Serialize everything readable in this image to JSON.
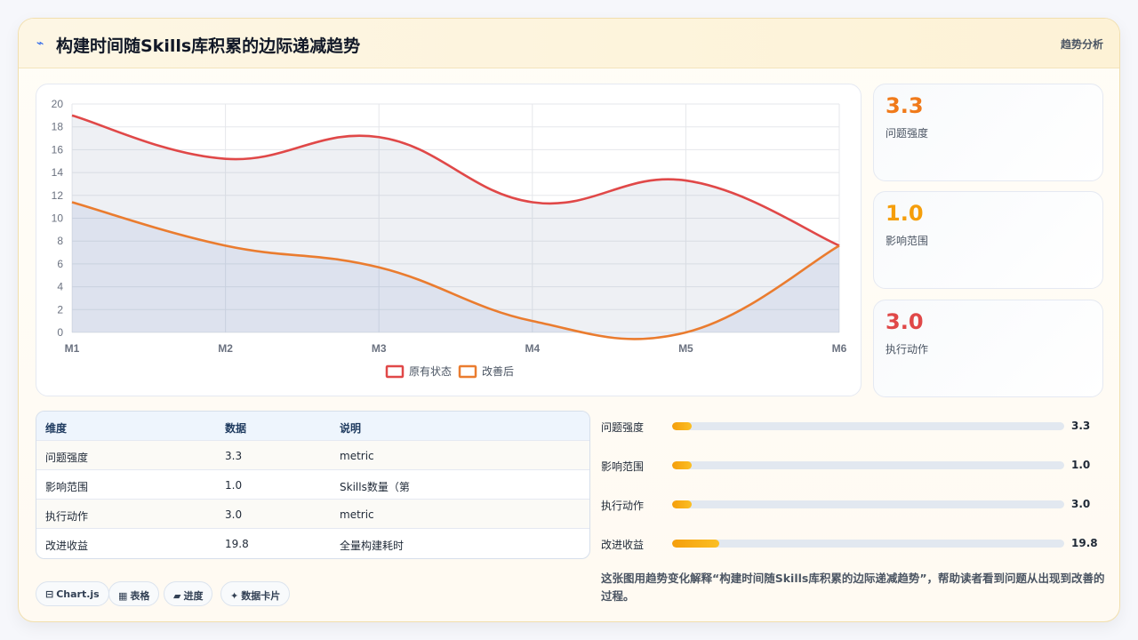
{
  "header": {
    "icon": "trend-icon",
    "title": "构建时间随Skills库积累的边际递减趋势",
    "tag": "趋势分析"
  },
  "chart_data": {
    "type": "line",
    "categories": [
      "M1",
      "M2",
      "M3",
      "M4",
      "M5",
      "M6"
    ],
    "ylim": [
      0,
      20
    ],
    "yticks": [
      0,
      2,
      4,
      6,
      8,
      10,
      12,
      14,
      16,
      18,
      20
    ],
    "grid": true,
    "legend_position": "bottom",
    "series": [
      {
        "name": "原有状态",
        "values": [
          19.0,
          15.2,
          17.1,
          11.4,
          13.3,
          7.6
        ],
        "color": "#e04848"
      },
      {
        "name": "改善后",
        "values": [
          11.4,
          7.6,
          5.7,
          1.0,
          0.0,
          7.6
        ],
        "color": "#ea7c2f"
      }
    ]
  },
  "stats": [
    {
      "value": "3.3",
      "label": "问题强度",
      "color": "#f07a1a"
    },
    {
      "value": "1.0",
      "label": "影响范围",
      "color": "#f59e0b"
    },
    {
      "value": "3.0",
      "label": "执行动作",
      "color": "#e04848"
    }
  ],
  "table": {
    "headers": [
      "维度",
      "数据",
      "说明"
    ],
    "rows": [
      [
        "问题强度",
        "3.3",
        "metric"
      ],
      [
        "影响范围",
        "1.0",
        "Skills数量（第"
      ],
      [
        "执行动作",
        "3.0",
        "metric"
      ],
      [
        "改进收益",
        "19.8",
        "全量构建耗时"
      ]
    ]
  },
  "bars": [
    {
      "label": "问题强度",
      "value": "3.3",
      "fraction": 0.05
    },
    {
      "label": "影响范围",
      "value": "1.0",
      "fraction": 0.05
    },
    {
      "label": "执行动作",
      "value": "3.0",
      "fraction": 0.05
    },
    {
      "label": "改进收益",
      "value": "19.8",
      "fraction": 0.12
    }
  ],
  "pills": [
    {
      "icon": "database-icon",
      "glyph": "⊟",
      "label": "Chart.js"
    },
    {
      "icon": "table-icon",
      "glyph": "▦",
      "label": "表格"
    },
    {
      "icon": "progress-icon",
      "glyph": "▰",
      "label": "进度"
    },
    {
      "icon": "sparkle-icon",
      "glyph": "✦",
      "label": "数据卡片"
    }
  ],
  "caption": "这张图用趋势变化解释“构建时间随Skills库积累的边际递减趋势”，帮助读者看到问题从出现到改善的过程。"
}
